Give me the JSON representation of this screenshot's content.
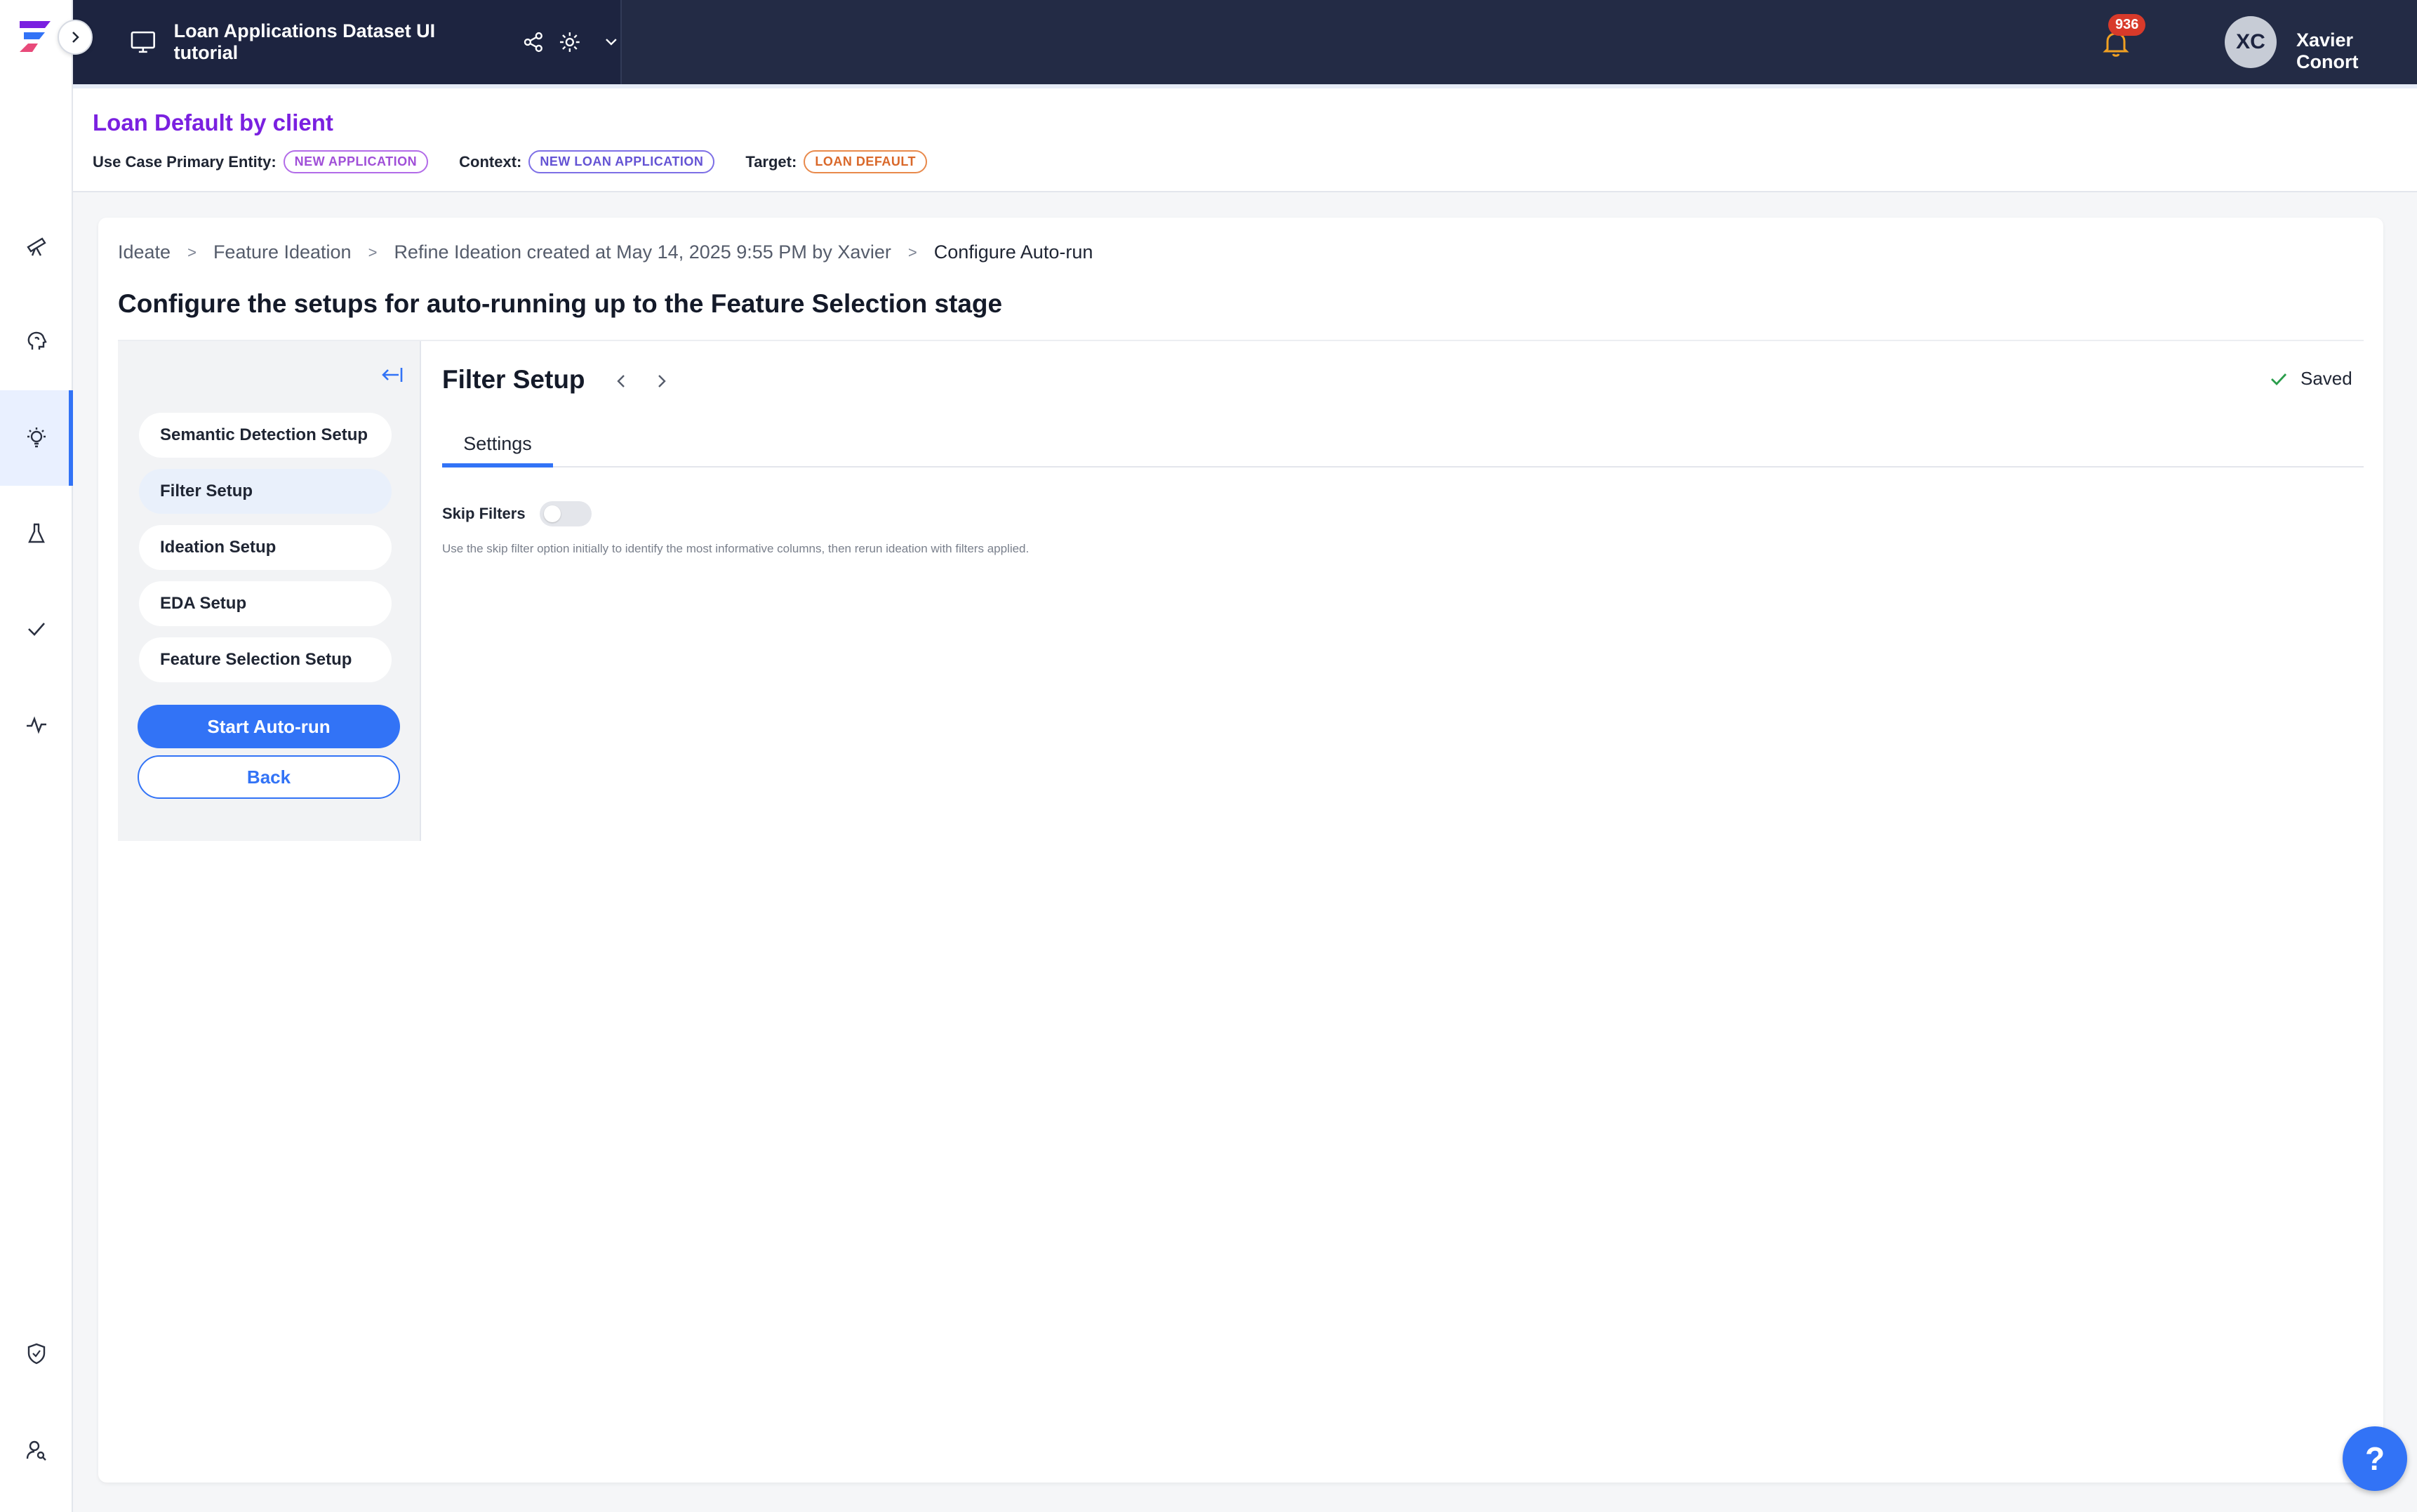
{
  "header": {
    "project_title": "Loan Applications Dataset UI tutorial",
    "notification_count": "936",
    "user_initials": "XC",
    "user_name": "Xavier Conort"
  },
  "use_case": {
    "title": "Loan Default by client",
    "primary_entity_label": "Use Case Primary Entity:",
    "primary_entity_value": "NEW APPLICATION",
    "context_label": "Context:",
    "context_value": "NEW LOAN APPLICATION",
    "target_label": "Target:",
    "target_value": "LOAN DEFAULT"
  },
  "breadcrumb": {
    "items": [
      "Ideate",
      "Feature Ideation",
      "Refine Ideation created at May 14, 2025 9:55 PM by Xavier",
      "Configure Auto-run"
    ],
    "separator": ">"
  },
  "page_title": "Configure the setups for auto-running up to the Feature Selection stage",
  "steps": {
    "items": [
      {
        "label": "Semantic Detection Setup"
      },
      {
        "label": "Filter Setup"
      },
      {
        "label": "Ideation Setup"
      },
      {
        "label": "EDA Setup"
      },
      {
        "label": "Feature Selection Setup"
      }
    ],
    "active_index": 1,
    "start_label": "Start Auto-run",
    "back_label": "Back"
  },
  "pane": {
    "title": "Filter Setup",
    "saved_label": "Saved",
    "tabs": [
      {
        "label": "Settings"
      }
    ],
    "skip_filters_label": "Skip Filters",
    "skip_filters_on": false,
    "skip_filters_description": "Use the skip filter option initially to identify the most informative columns, then rerun ideation with filters applied."
  },
  "help_label": "?",
  "icons": {
    "rail": [
      "logo-icon",
      "expand-icon",
      "telescope-icon",
      "brain-icon",
      "lightbulb-icon",
      "flask-icon",
      "check-icon",
      "pulse-icon",
      "shield-icon",
      "user-search-icon"
    ]
  },
  "colors": {
    "accent": "#3273f6",
    "topbar": "#232b45",
    "usecase_title": "#7a20e0",
    "chip_purple": "#a04fd8",
    "chip_indigo": "#6453d4",
    "chip_orange": "#d9682a",
    "badge": "#d83a2a"
  }
}
